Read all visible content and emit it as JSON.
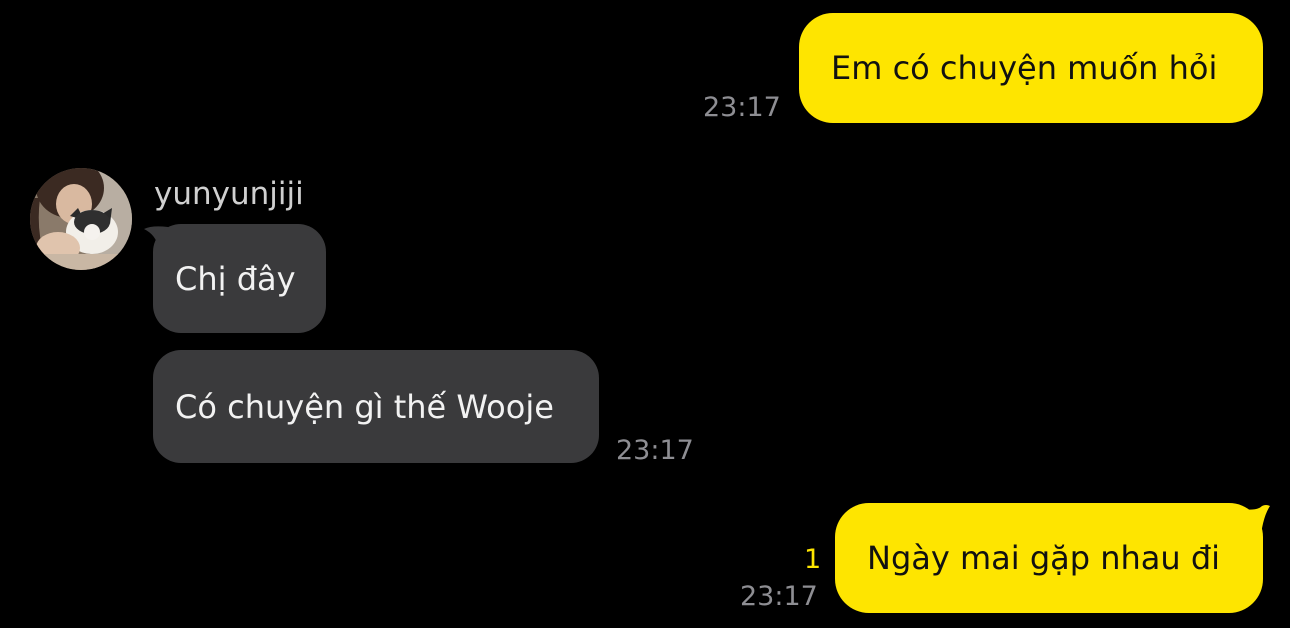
{
  "conversation": {
    "messages": [
      {
        "direction": "outgoing",
        "text": "Em có chuyện muốn hỏi",
        "time": "23:17"
      },
      {
        "direction": "incoming",
        "sender": "yunyunjiji",
        "avatar_icon": "profile-photo-girl-with-cat",
        "text": "Chị đây"
      },
      {
        "direction": "incoming",
        "text": "Có chuyện gì thế Wooje",
        "time": "23:17"
      },
      {
        "direction": "outgoing",
        "text": "Ngày mai gặp nhau đi",
        "time": "23:17",
        "unread_count": "1"
      }
    ]
  },
  "colors": {
    "background": "#000000",
    "outgoing_bubble": "#FEE500",
    "incoming_bubble": "#3a3a3c",
    "timestamp": "#8e8e93",
    "unread": "#FEE500"
  }
}
